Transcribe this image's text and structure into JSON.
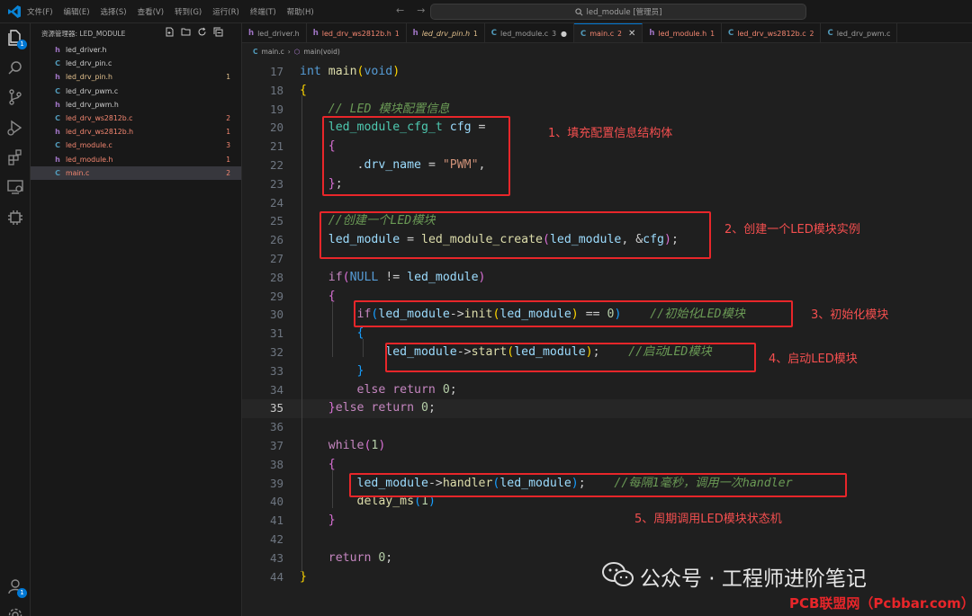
{
  "titlebar": {
    "menu": [
      "文件(F)",
      "编辑(E)",
      "选择(S)",
      "查看(V)",
      "转到(G)",
      "运行(R)",
      "终端(T)",
      "帮助(H)"
    ],
    "search_text": "led_module [管理员]"
  },
  "activity": {
    "icons": [
      "explorer-icon",
      "search-icon",
      "source-control-icon",
      "run-debug-icon",
      "extensions-icon",
      "remote-explorer-icon",
      "gear-chip-icon"
    ],
    "explorer_badge": "1",
    "account_badge": "1"
  },
  "sidebar": {
    "title": "资源管理器: LED_MODULE",
    "files": [
      {
        "icon": "h",
        "name": "led_driver.h",
        "count": "",
        "status": ""
      },
      {
        "icon": "C",
        "name": "led_drv_pin.c",
        "count": "",
        "status": ""
      },
      {
        "icon": "h",
        "name": "led_drv_pin.h",
        "count": "1",
        "status": "mod"
      },
      {
        "icon": "C",
        "name": "led_drv_pwm.c",
        "count": "",
        "status": ""
      },
      {
        "icon": "h",
        "name": "led_drv_pwm.h",
        "count": "",
        "status": ""
      },
      {
        "icon": "C",
        "name": "led_drv_ws2812b.c",
        "count": "2",
        "status": "err"
      },
      {
        "icon": "h",
        "name": "led_drv_ws2812b.h",
        "count": "1",
        "status": "err"
      },
      {
        "icon": "C",
        "name": "led_module.c",
        "count": "3",
        "status": "err"
      },
      {
        "icon": "h",
        "name": "led_module.h",
        "count": "1",
        "status": "err"
      },
      {
        "icon": "C",
        "name": "main.c",
        "count": "2",
        "status": "err"
      }
    ]
  },
  "tabs": [
    {
      "icon": "h",
      "name": "led_driver.h",
      "count": "",
      "status": "",
      "active": false
    },
    {
      "icon": "h",
      "name": "led_drv_ws2812b.h",
      "count": "1",
      "status": "err",
      "active": false
    },
    {
      "icon": "h",
      "name": "led_drv_pin.h",
      "count": "1",
      "status": "mod",
      "active": false,
      "italic": true
    },
    {
      "icon": "C",
      "name": "led_module.c",
      "count": "3",
      "status": "",
      "active": false,
      "dot": true
    },
    {
      "icon": "C",
      "name": "main.c",
      "count": "2",
      "status": "err",
      "active": true
    },
    {
      "icon": "h",
      "name": "led_module.h",
      "count": "1",
      "status": "err",
      "active": false
    },
    {
      "icon": "C",
      "name": "led_drv_ws2812b.c",
      "count": "2",
      "status": "err",
      "active": false
    },
    {
      "icon": "C",
      "name": "led_drv_pwm.c",
      "count": "",
      "status": "",
      "active": false
    }
  ],
  "breadcrumb": {
    "file": "main.c",
    "symbol": "main(void)"
  },
  "code": {
    "current_line": 35,
    "lines": [
      {
        "n": "17",
        "tokens": [
          [
            "kw",
            "int "
          ],
          [
            "fn",
            "main"
          ],
          [
            "br1",
            "("
          ],
          [
            "kw",
            "void"
          ],
          [
            "br1",
            ")"
          ]
        ]
      },
      {
        "n": "18",
        "tokens": [
          [
            "br1",
            "{"
          ]
        ]
      },
      {
        "n": "19",
        "tokens": [
          [
            "",
            "    "
          ],
          [
            "cm",
            "// LED 模块配置信息"
          ]
        ]
      },
      {
        "n": "20",
        "tokens": [
          [
            "",
            "    "
          ],
          [
            "ty",
            "led_module_cfg_t "
          ],
          [
            "var",
            "cfg"
          ],
          [
            "",
            " ="
          ]
        ]
      },
      {
        "n": "21",
        "tokens": [
          [
            "",
            "    "
          ],
          [
            "br2",
            "{"
          ]
        ]
      },
      {
        "n": "22",
        "tokens": [
          [
            "",
            "        ."
          ],
          [
            "var",
            "drv_name"
          ],
          [
            "",
            " = "
          ],
          [
            "str",
            "\"PWM\""
          ],
          [
            ",",
            ","
          ]
        ]
      },
      {
        "n": "23",
        "tokens": [
          [
            "",
            "    "
          ],
          [
            "br2",
            "}"
          ],
          [
            "",
            ";"
          ]
        ]
      },
      {
        "n": "24",
        "tokens": []
      },
      {
        "n": "25",
        "tokens": [
          [
            "",
            "    "
          ],
          [
            "cm",
            "//创建一个LED模块"
          ]
        ]
      },
      {
        "n": "26",
        "tokens": [
          [
            "",
            "    "
          ],
          [
            "var",
            "led_module"
          ],
          [
            "",
            " = "
          ],
          [
            "fn",
            "led_module_create"
          ],
          [
            "br2",
            "("
          ],
          [
            "var",
            "led_module"
          ],
          [
            "",
            ", &"
          ],
          [
            "var",
            "cfg"
          ],
          [
            "br2",
            ")"
          ],
          [
            "",
            ";"
          ]
        ]
      },
      {
        "n": "27",
        "tokens": []
      },
      {
        "n": "28",
        "tokens": [
          [
            "",
            "    "
          ],
          [
            "ctl",
            "if"
          ],
          [
            "br2",
            "("
          ],
          [
            "kw",
            "NULL"
          ],
          [
            "",
            " != "
          ],
          [
            "var",
            "led_module"
          ],
          [
            "br2",
            ")"
          ]
        ]
      },
      {
        "n": "29",
        "tokens": [
          [
            "",
            "    "
          ],
          [
            "br2",
            "{"
          ]
        ]
      },
      {
        "n": "30",
        "tokens": [
          [
            "",
            "        "
          ],
          [
            "ctl",
            "if"
          ],
          [
            "br3",
            "("
          ],
          [
            "var",
            "led_module"
          ],
          [
            "",
            "->"
          ],
          [
            "fn",
            "init"
          ],
          [
            "br1",
            "("
          ],
          [
            "var",
            "led_module"
          ],
          [
            "br1",
            ")"
          ],
          [
            "",
            " == "
          ],
          [
            "num",
            "0"
          ],
          [
            "br3",
            ")"
          ],
          [
            "",
            "    "
          ],
          [
            "cm",
            "//初始化LED模块"
          ]
        ]
      },
      {
        "n": "31",
        "tokens": [
          [
            "",
            "        "
          ],
          [
            "br3",
            "{"
          ]
        ]
      },
      {
        "n": "32",
        "tokens": [
          [
            "",
            "            "
          ],
          [
            "var",
            "led_module"
          ],
          [
            "",
            "->"
          ],
          [
            "fn",
            "start"
          ],
          [
            "br1",
            "("
          ],
          [
            "var",
            "led_module"
          ],
          [
            "br1",
            ")"
          ],
          [
            "",
            ";    "
          ],
          [
            "cm",
            "//启动LED模块"
          ]
        ]
      },
      {
        "n": "33",
        "tokens": [
          [
            "",
            "        "
          ],
          [
            "br3",
            "}"
          ]
        ]
      },
      {
        "n": "34",
        "tokens": [
          [
            "",
            "        "
          ],
          [
            "ctl",
            "else return "
          ],
          [
            "num",
            "0"
          ],
          [
            "",
            ";"
          ]
        ]
      },
      {
        "n": "35",
        "tokens": [
          [
            "",
            "    "
          ],
          [
            "br2",
            "}"
          ],
          [
            "ctl",
            "else return "
          ],
          [
            "num",
            "0"
          ],
          [
            "",
            ";"
          ]
        ]
      },
      {
        "n": "36",
        "tokens": []
      },
      {
        "n": "37",
        "tokens": [
          [
            "",
            "    "
          ],
          [
            "ctl",
            "while"
          ],
          [
            "br2",
            "("
          ],
          [
            "num",
            "1"
          ],
          [
            "br2",
            ")"
          ]
        ]
      },
      {
        "n": "38",
        "tokens": [
          [
            "",
            "    "
          ],
          [
            "br2",
            "{"
          ]
        ]
      },
      {
        "n": "39",
        "tokens": [
          [
            "",
            "        "
          ],
          [
            "var",
            "led_module"
          ],
          [
            "",
            "->"
          ],
          [
            "fn",
            "handler"
          ],
          [
            "br3",
            "("
          ],
          [
            "var",
            "led_module"
          ],
          [
            "br3",
            ")"
          ],
          [
            "",
            ";    "
          ],
          [
            "cm",
            "//每隔1毫秒，调用一次handler"
          ]
        ]
      },
      {
        "n": "40",
        "tokens": [
          [
            "",
            "        "
          ],
          [
            "fn",
            "delay_ms"
          ],
          [
            "br3",
            "("
          ],
          [
            "num",
            "1"
          ],
          [
            "br3",
            ")"
          ]
        ]
      },
      {
        "n": "41",
        "tokens": [
          [
            "",
            "    "
          ],
          [
            "br2",
            "}"
          ]
        ]
      },
      {
        "n": "42",
        "tokens": []
      },
      {
        "n": "43",
        "tokens": [
          [
            "",
            "    "
          ],
          [
            "ctl",
            "return "
          ],
          [
            "num",
            "0"
          ],
          [
            "",
            ";"
          ]
        ]
      },
      {
        "n": "44",
        "tokens": [
          [
            "br1",
            "}"
          ]
        ]
      }
    ]
  },
  "annotations": [
    "1、填充配置信息结构体",
    "2、创建一个LED模块实例",
    "3、初始化模块",
    "4、启动LED模块",
    "5、周期调用LED模块状态机"
  ],
  "watermark": {
    "text": "公众号 · 工程师进阶笔记",
    "site": "PCB联盟网（Pcbbar.com）"
  },
  "colors": {
    "accent": "#0078d4",
    "annotation": "#e8262a"
  }
}
